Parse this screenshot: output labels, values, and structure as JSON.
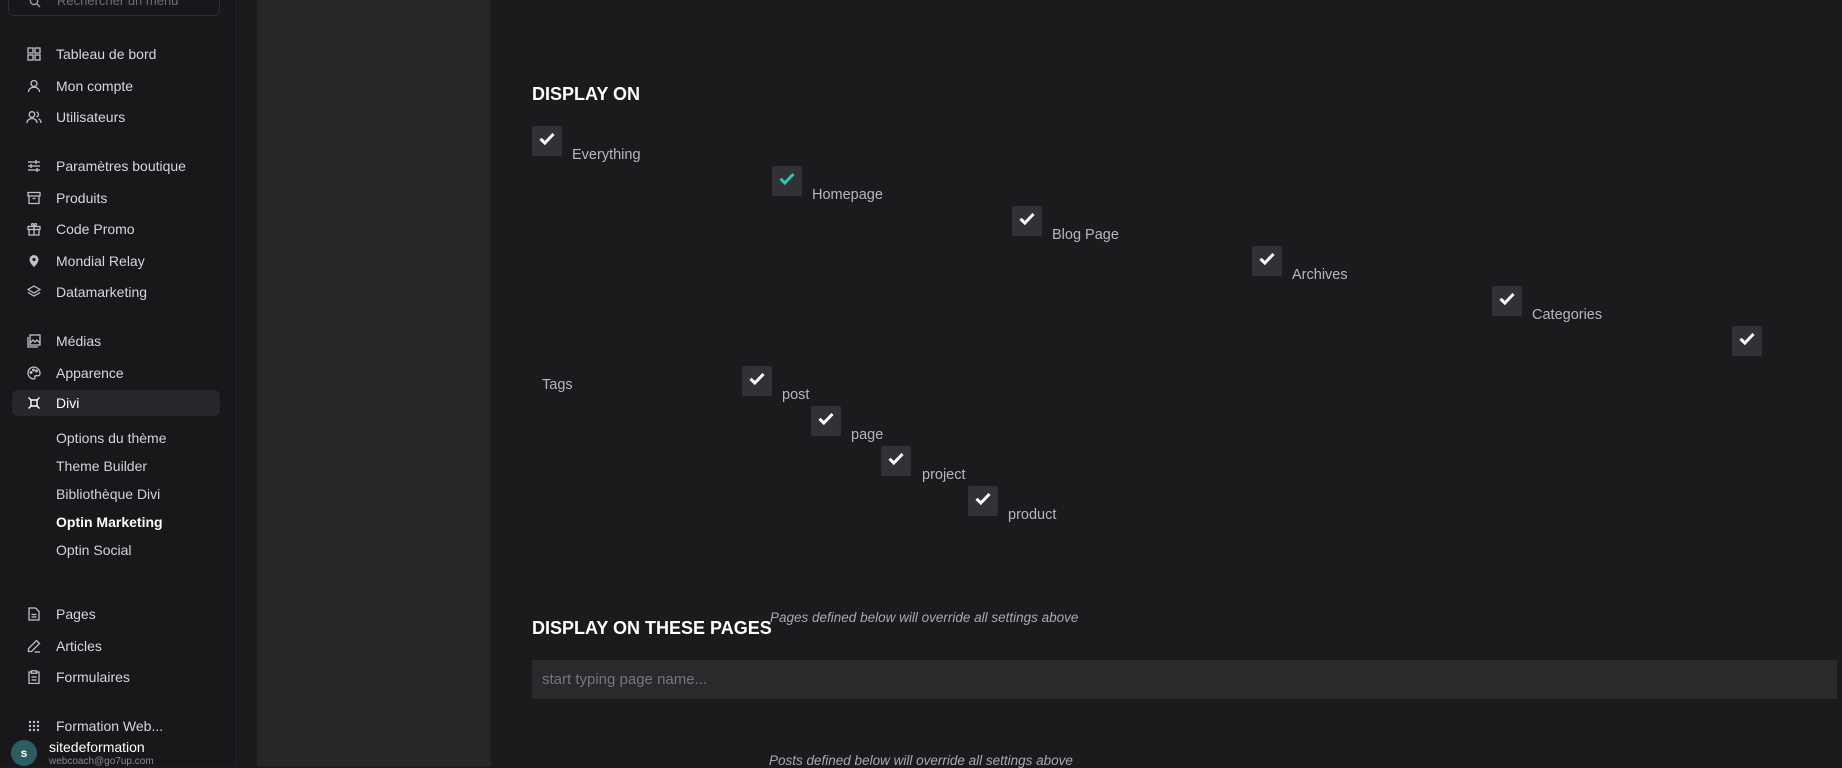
{
  "sidebar": {
    "search_placeholder": "Rechercher un menu",
    "items": [
      {
        "label": "Tableau de bord",
        "icon": "dashboard-grid-icon"
      },
      {
        "label": "Mon compte",
        "icon": "user-icon"
      },
      {
        "label": "Utilisateurs",
        "icon": "users-icon"
      },
      {
        "label": "Paramètres boutique",
        "icon": "sliders-icon"
      },
      {
        "label": "Produits",
        "icon": "archive-box-icon"
      },
      {
        "label": "Code Promo",
        "icon": "gift-icon"
      },
      {
        "label": "Mondial Relay",
        "icon": "map-pin-icon"
      },
      {
        "label": "Datamarketing",
        "icon": "layers-icon"
      },
      {
        "label": "Médias",
        "icon": "images-icon"
      },
      {
        "label": "Apparence",
        "icon": "palette-icon"
      },
      {
        "label": "Divi",
        "icon": "divi-icon"
      },
      {
        "label": "Pages",
        "icon": "file-text-icon"
      },
      {
        "label": "Articles",
        "icon": "pen-icon"
      },
      {
        "label": "Formulaires",
        "icon": "clipboard-icon"
      },
      {
        "label": "Formation Web...",
        "icon": "apps-grid-icon"
      }
    ],
    "divi_submenu": [
      "Options du thème",
      "Theme Builder",
      "Bibliothèque Divi",
      "Optin Marketing",
      "Optin Social"
    ],
    "user": {
      "initial": "s",
      "name": "sitedeformation",
      "email": "webcoach@go7up.com"
    }
  },
  "main": {
    "display_on": {
      "title": "DISPLAY ON",
      "options": [
        {
          "label": "Everything",
          "checked": true
        },
        {
          "label": "Homepage",
          "checked": true
        },
        {
          "label": "Blog Page",
          "checked": true
        },
        {
          "label": "Archives",
          "checked": true
        },
        {
          "label": "Categories",
          "checked": true
        },
        {
          "label": "Tags",
          "checked": true
        },
        {
          "label": "post",
          "checked": true
        },
        {
          "label": "page",
          "checked": true
        },
        {
          "label": "project",
          "checked": true
        },
        {
          "label": "product",
          "checked": true
        }
      ]
    },
    "display_on_pages": {
      "title": "DISPLAY ON THESE PAGES",
      "note": "Pages defined below will override all settings above",
      "input_placeholder": "start typing page name..."
    },
    "posts_note": "Posts defined below will override all settings above"
  },
  "colors": {
    "check": "#ffffff",
    "check_highlight": "#2ec4b6",
    "accent_avatar": "#2b5d63"
  }
}
